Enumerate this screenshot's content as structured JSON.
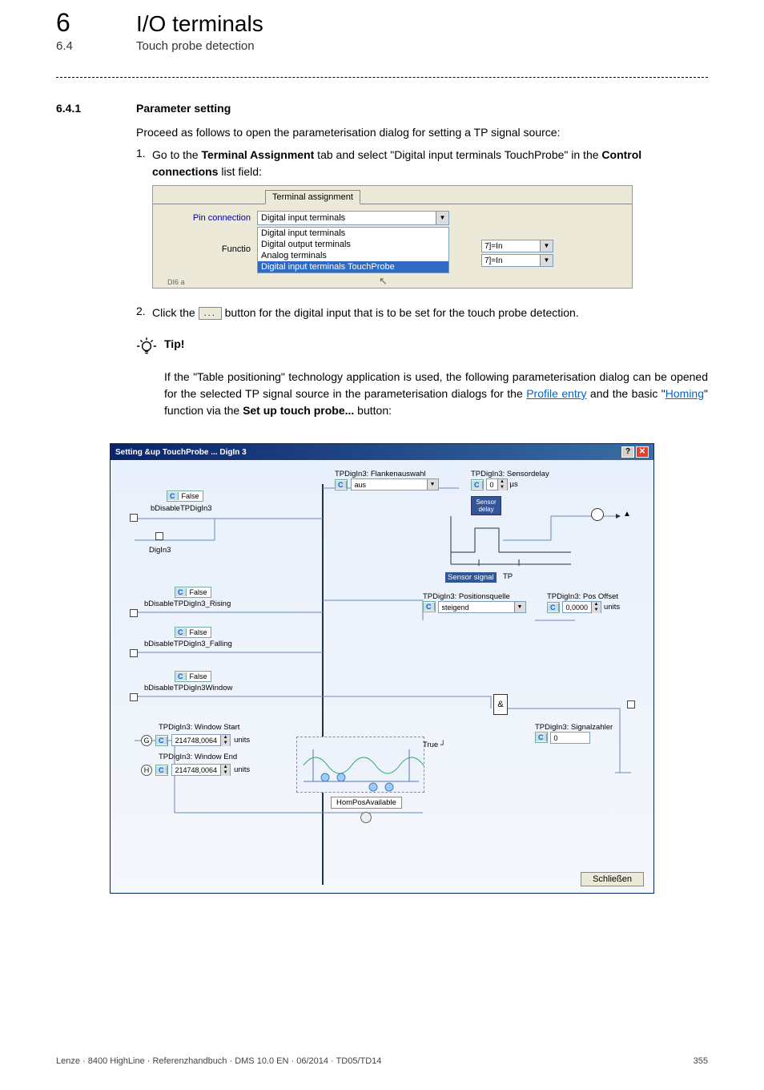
{
  "header": {
    "chapter_num": "6",
    "chapter_title": "I/O terminals",
    "sub_num": "6.4",
    "sub_title": "Touch probe detection"
  },
  "section": {
    "num": "6.4.1",
    "title": "Parameter setting",
    "intro": "Proceed as follows to open the parameterisation dialog for setting a TP signal source:",
    "step1_num": "1.",
    "step1_a": "Go to the ",
    "step1_bold1": "Terminal Assignment",
    "step1_b": " tab and select \"Digital input terminals TouchProbe\" in the ",
    "step1_bold2": "Control connections",
    "step1_c": " list field:",
    "step2_num": "2.",
    "step2_a": "Click the ",
    "step2_btn": "...",
    "step2_b": " button for the digital input that is to be set for the touch probe detection."
  },
  "screenshot1": {
    "tab": "Terminal assignment",
    "label_pin": "Pin connection",
    "dd_value": "Digital input terminals",
    "list_items": [
      "Digital input terminals",
      "Digital output terminals",
      "Analog terminals",
      "Digital input terminals TouchProbe"
    ],
    "func_label": "Functio",
    "di6_label": "DI6 a",
    "right1": "7]=In",
    "right2": "7]=In"
  },
  "tip": {
    "label": "Tip!",
    "body_a": "If the \"Table positioning\" technology application is used, the following parameterisation dialog can be opened for the selected TP signal source in the parameterisation dialogs for the ",
    "link1": "Profile entry",
    "body_b": " and the basic \"",
    "link2": "Homing",
    "body_c": "\" function via the ",
    "bold": "Set up touch probe...",
    "body_d": " button:"
  },
  "dialog": {
    "title": "Setting &up TouchProbe ... DigIn 3",
    "lbl_flanken": "TPDigIn3: Flankenauswahl",
    "flanken_val": "aus",
    "lbl_sensordelay": "TPDigIn3: Sensordelay",
    "sensordelay_val": "0",
    "sensordelay_unit": "µs",
    "sensor_delay_box": "Sensor delay",
    "sensor_signal": "Sensor signal",
    "tp_label": "TP",
    "c_false": "False",
    "sig_bdisable": "bDisableTPDigIn3",
    "sig_digin3": "DigIn3",
    "sig_rising": "bDisableTPDigIn3_Rising",
    "sig_falling": "bDisableTPDigIn3_Falling",
    "sig_window": "bDisableTPDigIn3Window",
    "lbl_posquelle": "TPDigIn3: Positionsquelle",
    "posquelle_val": "steigend",
    "lbl_posoffset": "TPDigIn3: Pos Offset",
    "posoffset_val": "0,0000",
    "units": "units",
    "lbl_winstart": "TPDigIn3: Window Start",
    "winstart_val": "214748,0064",
    "lbl_winend": "TPDigIn3: Window End",
    "winend_val": "214748,0064",
    "lbl_signalzahler": "TPDigIn3: Signalzahler",
    "signalzahler_val": "0",
    "g_badge": "G",
    "h_badge": "H",
    "true_label": "True",
    "hompos": "HomPosAvailable",
    "amp": "&",
    "close_btn": "Schließen"
  },
  "footer": {
    "left": "Lenze · 8400 HighLine · Referenzhandbuch · DMS 10.0 EN · 06/2014 · TD05/TD14",
    "right": "355"
  }
}
